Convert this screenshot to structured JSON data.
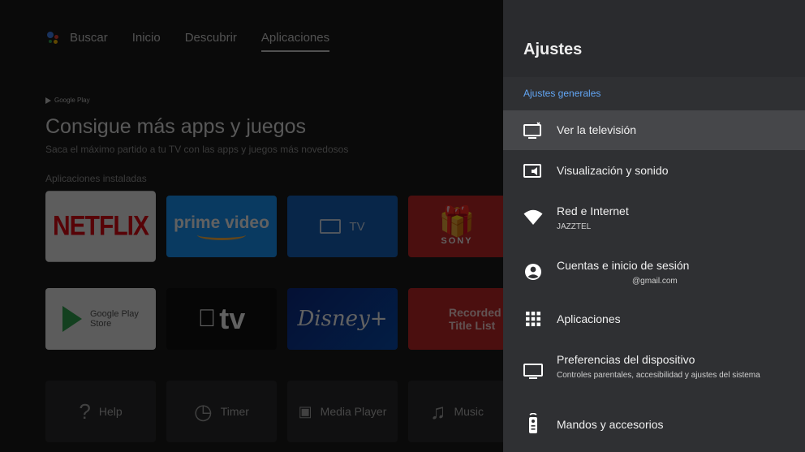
{
  "nav": {
    "items": [
      "Buscar",
      "Inicio",
      "Descubrir",
      "Aplicaciones"
    ]
  },
  "home": {
    "google_play": "Google Play",
    "headline": "Consigue más apps y juegos",
    "subtitle": "Saca el máximo partido a tu TV con las apps y juegos más novedosos",
    "section": "Aplicaciones instaladas",
    "tiles": {
      "netflix": "NETFLIX",
      "prime": "prime video",
      "tv": "TV",
      "sony": "SONY",
      "play_store": "Google Play Store",
      "appletv": "tv",
      "disney": "Disney+",
      "record": "Recorded Title List",
      "help": "Help",
      "timer": "Timer",
      "media": "Media Player",
      "music": "Music"
    }
  },
  "settings": {
    "title": "Ajustes",
    "category": "Ajustes generales",
    "items": [
      {
        "label": "Ver la televisión",
        "icon": "live-tv-icon"
      },
      {
        "label": "Visualización y sonido",
        "icon": "display-sound-icon"
      },
      {
        "label": "Red e Internet",
        "sub": "JAZZTEL",
        "icon": "wifi-icon"
      },
      {
        "label": "Cuentas e inicio de sesión",
        "sub": "@gmail.com",
        "icon": "account-icon"
      },
      {
        "label": "Aplicaciones",
        "icon": "apps-grid-icon"
      },
      {
        "label": "Preferencias del dispositivo",
        "sub": "Controles parentales, accesibilidad y ajustes del sistema",
        "icon": "tv-icon"
      },
      {
        "label": "Mandos y accesorios",
        "icon": "remote-icon"
      }
    ]
  },
  "colors": {
    "panel": "#2f3033",
    "selected_row": "#46474a",
    "accent": "#62a6f5"
  }
}
